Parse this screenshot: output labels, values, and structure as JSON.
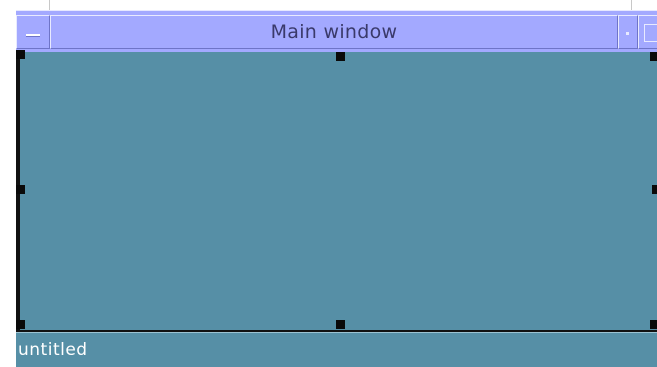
{
  "window": {
    "title": "Main window",
    "status_text": "untitled"
  },
  "icons": {
    "window_menu": "window-menu-icon",
    "minimize": "minimize-icon",
    "maximize": "maximize-icon",
    "selection_handle": "selection-handle"
  },
  "colors": {
    "titlebar": "#a3a9ff",
    "canvas": "#568fa6",
    "handle": "#0a0a0a",
    "title_text": "#3a3a6a",
    "status_text": "#ffffff"
  }
}
